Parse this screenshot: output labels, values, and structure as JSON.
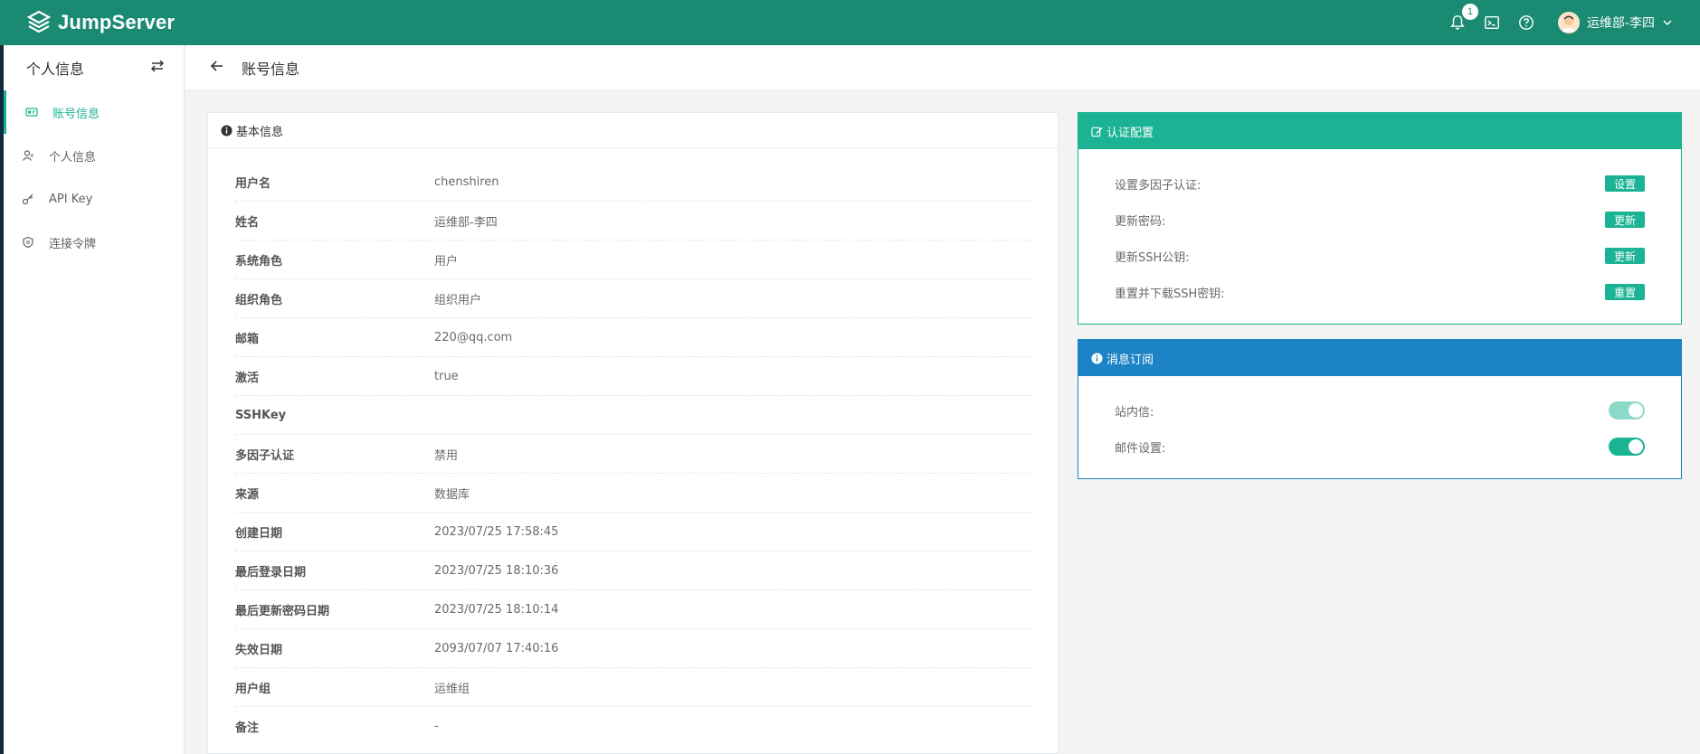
{
  "app": {
    "name": "JumpServer"
  },
  "topbar": {
    "notification_count": "1",
    "user_name": "运维部-李四"
  },
  "sidebar": {
    "title": "个人信息",
    "items": [
      {
        "label": "账号信息",
        "icon": "id-card-icon",
        "active": true
      },
      {
        "label": "个人信息",
        "icon": "user-icon",
        "active": false
      },
      {
        "label": "API Key",
        "icon": "key-icon",
        "active": false
      },
      {
        "label": "连接令牌",
        "icon": "token-icon",
        "active": false
      }
    ]
  },
  "page": {
    "title": "账号信息"
  },
  "basic_info": {
    "title": "基本信息",
    "rows": [
      {
        "label": "用户名",
        "value": "chenshiren"
      },
      {
        "label": "姓名",
        "value": "运维部-李四"
      },
      {
        "label": "系统角色",
        "value": "用户"
      },
      {
        "label": "组织角色",
        "value": "组织用户"
      },
      {
        "label": "邮箱",
        "value": "220@qq.com"
      },
      {
        "label": "激活",
        "value": "true"
      },
      {
        "label": "SSHKey",
        "value": ""
      },
      {
        "label": "多因子认证",
        "value": "禁用"
      },
      {
        "label": "来源",
        "value": "数据库"
      },
      {
        "label": "创建日期",
        "value": "2023/07/25 17:58:45"
      },
      {
        "label": "最后登录日期",
        "value": "2023/07/25 18:10:36"
      },
      {
        "label": "最后更新密码日期",
        "value": "2023/07/25 18:10:14"
      },
      {
        "label": "失效日期",
        "value": "2093/07/07 17:40:16"
      },
      {
        "label": "用户组",
        "value": "运维组"
      },
      {
        "label": "备注",
        "value": "-"
      }
    ]
  },
  "auth_config": {
    "title": "认证配置",
    "rows": [
      {
        "label": "设置多因子认证:",
        "button": "设置"
      },
      {
        "label": "更新密码:",
        "button": "更新"
      },
      {
        "label": "更新SSH公钥:",
        "button": "更新"
      },
      {
        "label": "重置并下载SSH密钥:",
        "button": "重置"
      }
    ]
  },
  "subscription": {
    "title": "消息订阅",
    "rows": [
      {
        "label": "站内信:",
        "enabled": true,
        "disabled_control": true
      },
      {
        "label": "邮件设置:",
        "enabled": true,
        "disabled_control": false
      }
    ]
  },
  "colors": {
    "topbar": "#1a8a73",
    "primary": "#1ab394",
    "info": "#1c84c6"
  }
}
